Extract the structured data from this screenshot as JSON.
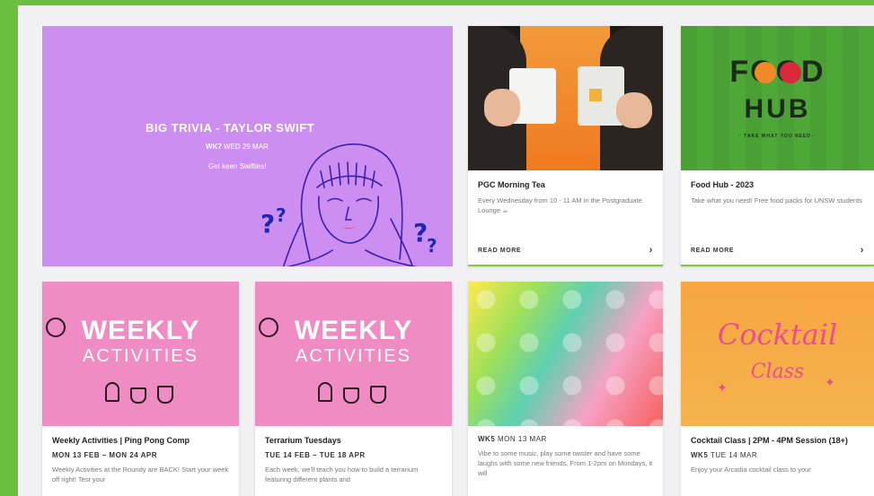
{
  "hero": {
    "title": "BIG TRIVIA - TAYLOR SWIFT",
    "week": "WK7",
    "date": "WED 29 MAR",
    "subtitle": "Get keen Swifties!"
  },
  "cards": [
    {
      "title": "PGC Morning Tea",
      "desc": "Every Wednesday from 10 - 11 AM in the Postgraduate Lounge ☕",
      "cta": "READ MORE"
    },
    {
      "title": "Food Hub - 2023",
      "desc": "Take what you need! Free food packs for UNSW students",
      "cta": "READ MORE",
      "logo_top": "FOOD",
      "logo_bottom": "HUB",
      "logo_tag": "· TAKE WHAT YOU NEED ·"
    },
    {
      "title": "Weekly Activities | Ping Pong Comp",
      "date": "MON 13 FEB – MON 24 APR",
      "desc": "Weekly Activities at the Roundy are BACK! Start your week off right! Test your",
      "banner_top": "WEEKLY",
      "banner_bottom": "ACTIVITIES"
    },
    {
      "title": "Terrarium Tuesdays",
      "date": "TUE 14 FEB – TUE 18 APR",
      "desc": "Each week, we'll teach you how to build a terrarium featuring different plants and",
      "banner_top": "WEEKLY",
      "banner_bottom": "ACTIVITIES"
    },
    {
      "week": "WK5",
      "date": "MON 13 MAR",
      "desc": "Vibe to some music, play some twister and have some laughs with some new friends. From 1-2pm on Mondays, it will"
    },
    {
      "title": "Cocktail Class | 2PM - 4PM Session (18+)",
      "week": "WK5",
      "date": "TUE 14 MAR",
      "desc": "Enjoy your Arcadia cocktail class to your",
      "script_top": "Cocktail",
      "script_bottom": "Class"
    }
  ],
  "colors": {
    "page_bg": "#6cbf3e",
    "hero_bg": "#cc8ef0",
    "weekly_pink": "#ef8cc3",
    "accent_green": "#8bc34a"
  }
}
